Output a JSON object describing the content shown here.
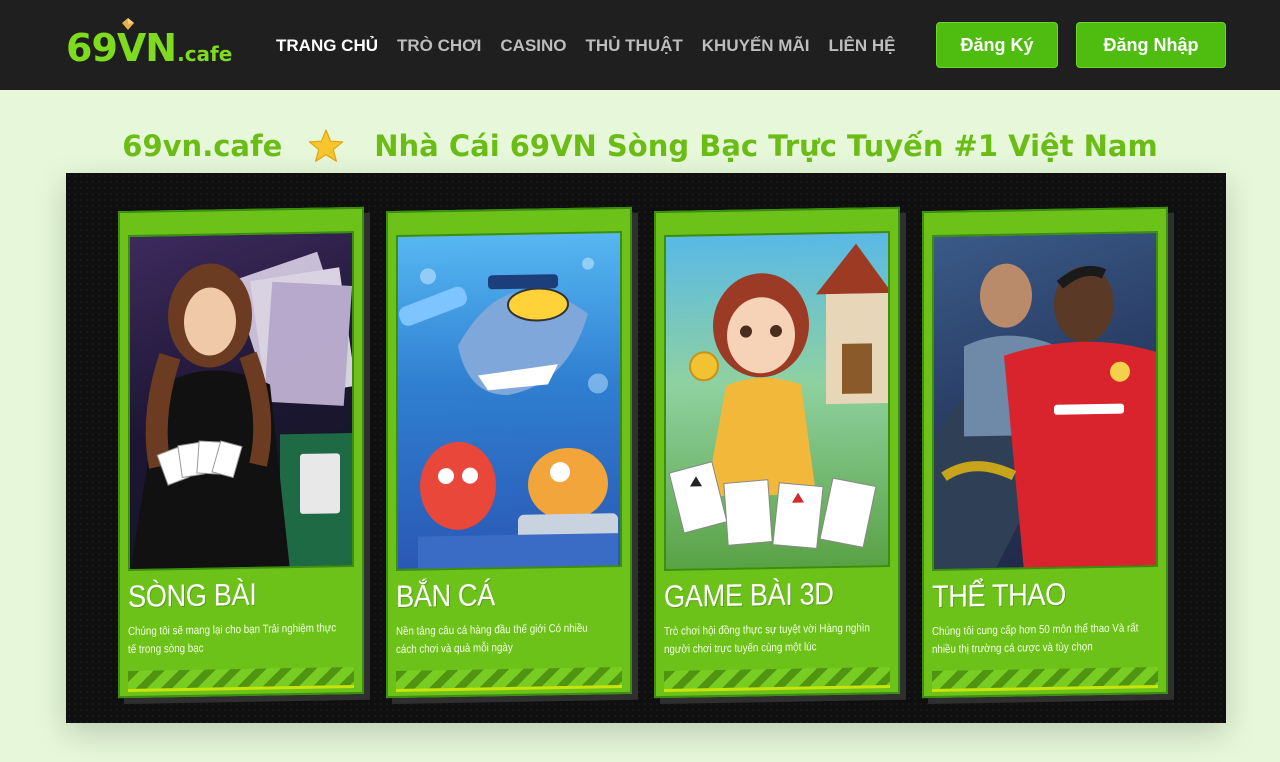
{
  "header": {
    "logo": {
      "main": "69VN",
      "sub": ".cafe"
    },
    "nav": [
      {
        "label": "TRANG CHỦ",
        "active": true
      },
      {
        "label": "TRÒ CHƠI",
        "active": false
      },
      {
        "label": "CASINO",
        "active": false
      },
      {
        "label": "THỦ THUẬT",
        "active": false
      },
      {
        "label": "KHUYẾN MÃI",
        "active": false
      },
      {
        "label": "LIÊN HỆ",
        "active": false
      }
    ],
    "register_label": "Đăng Ký",
    "login_label": "Đăng Nhập"
  },
  "hero": {
    "title_left": "69vn.cafe",
    "title_right": "Nhà Cái 69VN Sòng Bạc Trực Tuyến #1 Việt Nam",
    "star_icon": "star-icon"
  },
  "cards": [
    {
      "title": "SÒNG BÀI",
      "description": "Chúng tôi sẽ mang lại cho bạn Trải nghiệm thực tế trong sòng bạc",
      "image": "casino-dealer-image"
    },
    {
      "title": "BẮN CÁ",
      "description": "Nền tảng câu cá hàng đầu thế giới Có nhiều cách chơi và quà mỗi ngày",
      "image": "fish-shooting-image"
    },
    {
      "title": "GAME BÀI 3D",
      "description": "Trò chơi hội đồng thực sự tuyệt vời Hàng nghìn người chơi trực tuyến cùng một lúc",
      "image": "card-game-girl-image"
    },
    {
      "title": "THỂ THAO",
      "description": "Chúng tôi cung cấp hơn 50 môn thể thao Và rất nhiều thị trường cá cược và tùy chọn",
      "image": "football-players-image"
    }
  ],
  "colors": {
    "brand_green": "#6dc21a",
    "header_bg": "#1f1f1f",
    "page_bg": "#e6f8d9",
    "button_green": "#4fbd10",
    "title_green": "#6bbd16"
  }
}
